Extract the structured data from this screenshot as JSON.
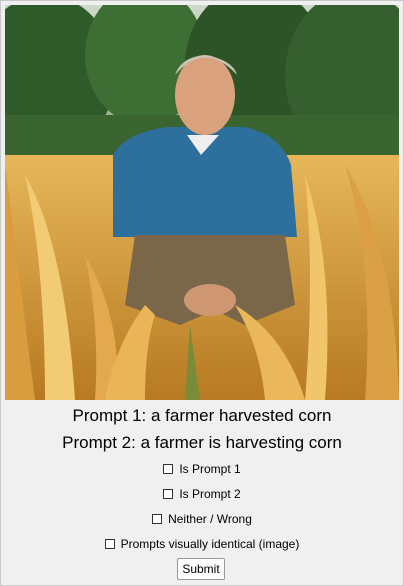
{
  "image": {
    "subject": "photo",
    "icon": "photo-image"
  },
  "prompts": {
    "prompt1": "Prompt 1: a farmer harvested corn",
    "prompt2": "Prompt 2: a farmer is harvesting corn"
  },
  "options": [
    {
      "label": "Is Prompt 1",
      "checked": false
    },
    {
      "label": "Is Prompt 2",
      "checked": false
    },
    {
      "label": "Neither / Wrong",
      "checked": false
    },
    {
      "label": "Prompts visually identical (image)",
      "checked": false
    }
  ],
  "submit_label": "Submit"
}
